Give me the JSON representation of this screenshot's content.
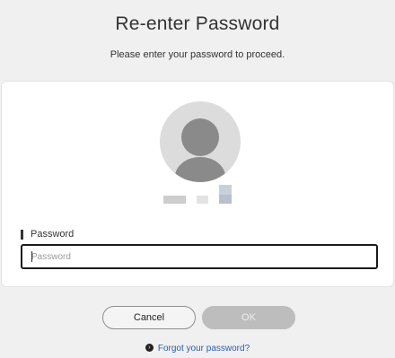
{
  "header": {
    "title": "Re-enter Password",
    "subtitle": "Please enter your password to proceed."
  },
  "account": {
    "avatar_icon": "user-avatar-icon",
    "username_obscured": true
  },
  "password_field": {
    "label": "Password",
    "placeholder": "Password",
    "value": ""
  },
  "actions": {
    "cancel_label": "Cancel",
    "ok_label": "OK",
    "ok_enabled": false
  },
  "forgot": {
    "icon": "chevron-right-circle-icon",
    "label": "Forgot your password?"
  },
  "colors": {
    "background": "#f0f0f0",
    "link": "#2a5db0",
    "ok_disabled": "#bdbdbd"
  }
}
